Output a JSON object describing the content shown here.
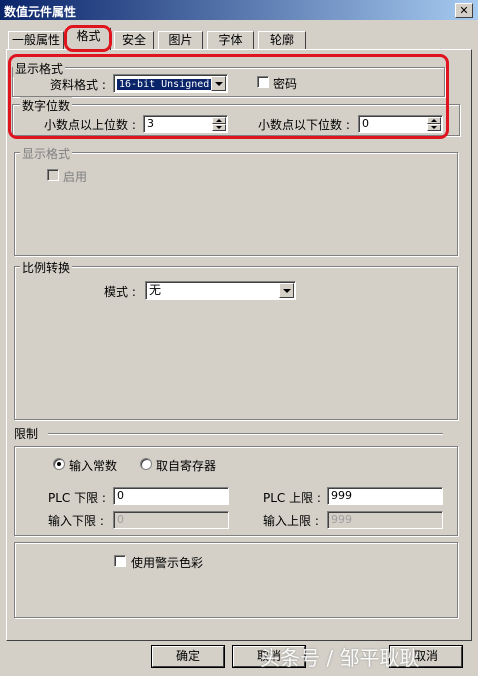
{
  "window": {
    "title": "数值元件属性",
    "close": "✕"
  },
  "tabs": [
    "一般属性",
    "格式",
    "安全",
    "图片",
    "字体",
    "轮廓"
  ],
  "display_format": {
    "legend": "显示格式",
    "data_format_label": "资料格式 :",
    "data_format_value": "16-bit Unsigned",
    "password_label": "密码"
  },
  "digits": {
    "legend": "数字位数",
    "int_label": "小数点以上位数 :",
    "int_value": "3",
    "frac_label": "小数点以下位数 :",
    "frac_value": "0"
  },
  "display_format2": {
    "legend": "显示格式",
    "enable_label": "启用"
  },
  "scaling": {
    "legend": "比例转换",
    "mode_label": "模式 :",
    "mode_value": "无"
  },
  "limits": {
    "legend": "限制",
    "radio_const": "输入常数",
    "radio_register": "取自寄存器",
    "plc_low_label": "PLC 下限 :",
    "plc_low_value": "0",
    "plc_high_label": "PLC 上限 :",
    "plc_high_value": "999",
    "input_low_label": "输入下限 :",
    "input_low_value": "0",
    "input_high_label": "输入上限 :",
    "input_high_value": "999"
  },
  "warning": {
    "label": "使用警示色彩"
  },
  "buttons": {
    "ok": "确定",
    "cancel": "取消",
    "third": "取消"
  },
  "watermark": "头条号 / 邹平耿耿",
  "colors": {
    "title_bar": "#0a246a",
    "highlight": "#e0141e",
    "dialog_bg": "#d4d0c8"
  }
}
